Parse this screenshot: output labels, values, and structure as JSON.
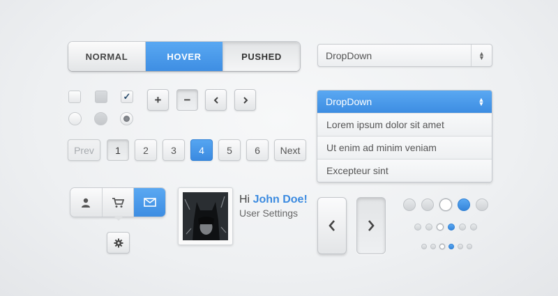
{
  "segmented": {
    "normal": "NORMAL",
    "hover": "HOVER",
    "pushed": "PUSHED"
  },
  "dropdown_closed": {
    "value": "DropDown"
  },
  "dropdown_open": {
    "value": "DropDown",
    "options": [
      "Lorem ipsum dolor sit amet",
      "Ut enim ad minim veniam",
      "Excepteur sint"
    ]
  },
  "stepper": {
    "plus": "+",
    "minus": "−",
    "prev": "‹",
    "next": "›"
  },
  "pagination": {
    "prev": "Prev",
    "pages": [
      "1",
      "2",
      "3",
      "4",
      "5",
      "6"
    ],
    "next": "Next",
    "active_page": "4"
  },
  "profile": {
    "greeting": "Hi",
    "name": "John Doe!",
    "subtitle": "User Settings"
  },
  "icons": {
    "user": "user-icon",
    "cart": "cart-icon",
    "mail": "mail-icon",
    "settings": "gear-icon"
  },
  "colors": {
    "accent": "#3e8ee3",
    "text": "#555555"
  }
}
